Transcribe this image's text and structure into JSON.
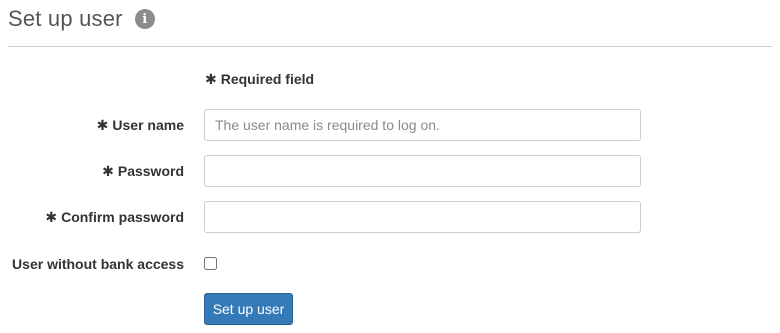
{
  "header": {
    "title": "Set up user",
    "info_icon": "info-circle-icon",
    "info_glyph": "i"
  },
  "required_note": {
    "star": "✱",
    "text": "Required field"
  },
  "fields": {
    "username": {
      "star": "✱",
      "label": "User name",
      "value": "",
      "placeholder": "The user name is required to log on."
    },
    "password": {
      "star": "✱",
      "label": "Password",
      "value": "",
      "placeholder": ""
    },
    "confirm_password": {
      "star": "✱",
      "label": "Confirm password",
      "value": "",
      "placeholder": ""
    },
    "no_bank_access": {
      "label": "User without bank access",
      "checked": false
    }
  },
  "actions": {
    "submit_label": "Set up user"
  },
  "colors": {
    "primary_button": "#337ab7",
    "info_icon": "#8c8c8c",
    "divider": "#cccccc"
  }
}
